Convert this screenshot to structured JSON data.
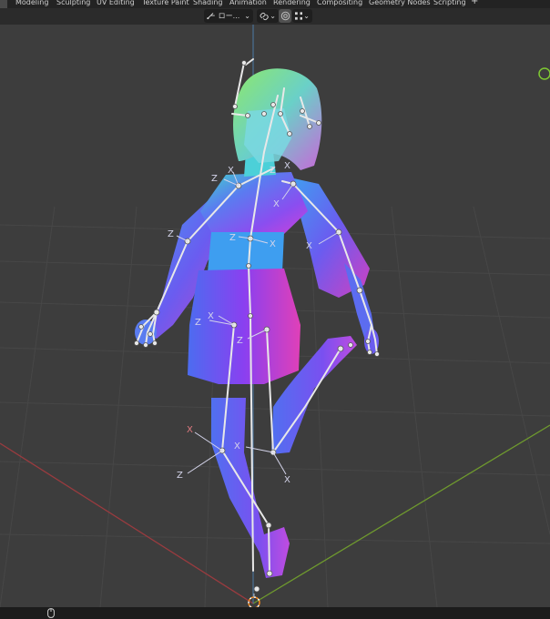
{
  "workspace_tabs": [
    {
      "label": "Modeling"
    },
    {
      "label": "Sculpting"
    },
    {
      "label": "UV Editing"
    },
    {
      "label": "Texture Paint"
    },
    {
      "label": "Shading"
    },
    {
      "label": "Animation"
    },
    {
      "label": "Rendering"
    },
    {
      "label": "Compositing"
    },
    {
      "label": "Geometry Nodes"
    },
    {
      "label": "Scripting"
    }
  ],
  "add_workspace_label": "+",
  "header": {
    "transform_orientation": "ロー...",
    "chevron": "⌄"
  },
  "colors": {
    "topbar_bg": "#232323",
    "header_bg": "#2b2b2b",
    "viewport_bg": "#3d3d3d",
    "grid_line": "#474747",
    "x_axis": "#9a3b3f",
    "y_axis": "#6f9a2e",
    "z_axis": "#4d7aa8",
    "bone": "#e8e8e8",
    "accent_orange": "#ff8c1a",
    "nav_gizmo": "#7ec832"
  },
  "bone_axis_labels": [
    {
      "text": "Z"
    },
    {
      "text": "X"
    },
    {
      "text": "Z"
    },
    {
      "text": "X"
    },
    {
      "text": "Z"
    },
    {
      "text": "X"
    },
    {
      "text": "Z"
    },
    {
      "text": "X"
    },
    {
      "text": "X"
    },
    {
      "text": "Z"
    },
    {
      "text": "Z"
    },
    {
      "text": "X"
    },
    {
      "text": "Z"
    },
    {
      "text": "X"
    },
    {
      "text": "X"
    },
    {
      "text": "X"
    }
  ],
  "status_icon": "mouse-icon"
}
